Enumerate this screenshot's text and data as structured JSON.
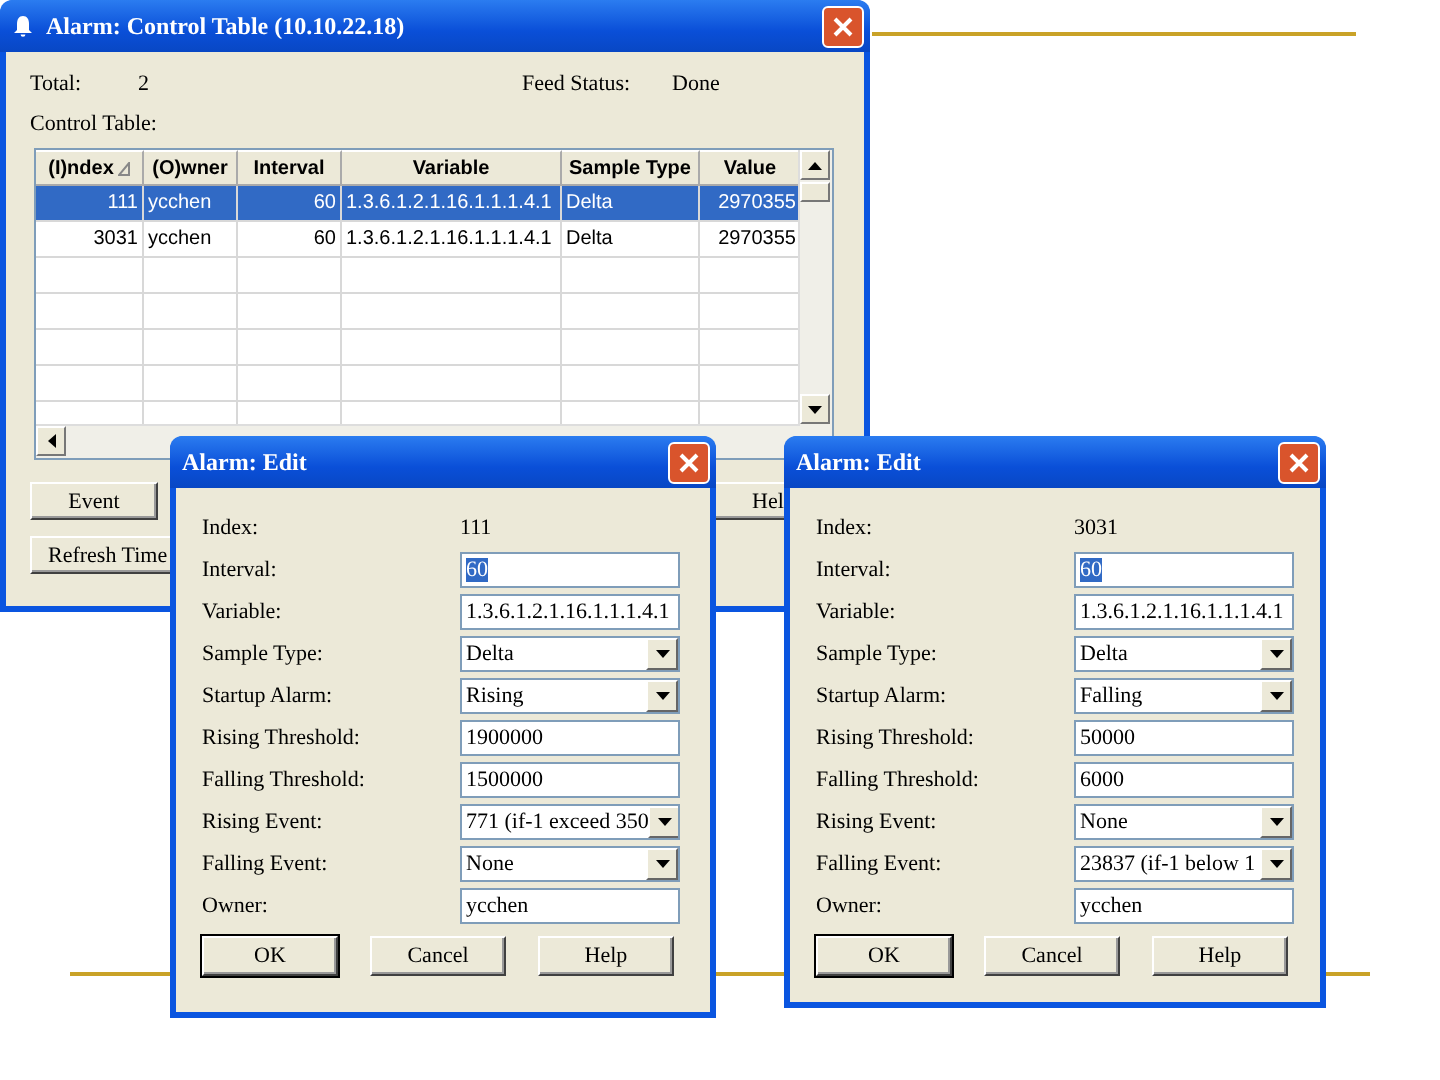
{
  "control_window": {
    "title": "Alarm: Control Table (10.10.22.18)",
    "total_label": "Total:",
    "total_value": "2",
    "feed_status_label": "Feed Status:",
    "feed_status_value": "Done",
    "table_label": "Control Table:",
    "table": {
      "columns": [
        {
          "label": "(I)ndex",
          "sorted": true
        },
        {
          "label": "(O)wner",
          "sorted": false
        },
        {
          "label": "Interval",
          "sorted": false
        },
        {
          "label": "Variable",
          "sorted": false
        },
        {
          "label": "Sample Type",
          "sorted": false
        },
        {
          "label": "Value",
          "sorted": false
        }
      ],
      "rows": [
        {
          "cells": [
            "111",
            "ycchen",
            "60",
            "1.3.6.1.2.1.16.1.1.1.4.1",
            "Delta",
            "2970355"
          ],
          "selected": true
        },
        {
          "cells": [
            "3031",
            "ycchen",
            "60",
            "1.3.6.1.2.1.16.1.1.1.4.1",
            "Delta",
            "2970355"
          ],
          "selected": false
        }
      ]
    },
    "buttons": [
      "Event",
      "Refresh Time",
      "Hel"
    ]
  },
  "edit_dialogs": [
    {
      "title": "Alarm: Edit",
      "fields": [
        {
          "label": "Index:",
          "kind": "static",
          "value": "111"
        },
        {
          "label": "Interval:",
          "kind": "text",
          "value": "60",
          "highlighted": true
        },
        {
          "label": "Variable:",
          "kind": "text",
          "value": "1.3.6.1.2.1.16.1.1.1.4.1",
          "highlighted": false
        },
        {
          "label": "Sample Type:",
          "kind": "dropdown",
          "value": "Delta"
        },
        {
          "label": "Startup Alarm:",
          "kind": "dropdown",
          "value": "Rising"
        },
        {
          "label": "Rising Threshold:",
          "kind": "text",
          "value": "1900000",
          "highlighted": false
        },
        {
          "label": "Falling Threshold:",
          "kind": "text",
          "value": "1500000",
          "highlighted": false
        },
        {
          "label": "Rising Event:",
          "kind": "dropdown",
          "value": "771 (if-1 exceed 350"
        },
        {
          "label": "Falling Event:",
          "kind": "dropdown",
          "value": "None"
        },
        {
          "label": "Owner:",
          "kind": "text",
          "value": "ycchen",
          "highlighted": false
        }
      ],
      "buttons": [
        {
          "label": "OK",
          "default": true
        },
        {
          "label": "Cancel",
          "default": false
        },
        {
          "label": "Help",
          "default": false
        }
      ]
    },
    {
      "title": "Alarm: Edit",
      "fields": [
        {
          "label": "Index:",
          "kind": "static",
          "value": "3031"
        },
        {
          "label": "Interval:",
          "kind": "text",
          "value": "60",
          "highlighted": true
        },
        {
          "label": "Variable:",
          "kind": "text",
          "value": "1.3.6.1.2.1.16.1.1.1.4.1",
          "highlighted": false
        },
        {
          "label": "Sample Type:",
          "kind": "dropdown",
          "value": "Delta"
        },
        {
          "label": "Startup Alarm:",
          "kind": "dropdown",
          "value": "Falling"
        },
        {
          "label": "Rising Threshold:",
          "kind": "text",
          "value": "50000",
          "highlighted": false
        },
        {
          "label": "Falling Threshold:",
          "kind": "text",
          "value": "6000",
          "highlighted": false
        },
        {
          "label": "Rising Event:",
          "kind": "dropdown",
          "value": "None"
        },
        {
          "label": "Falling Event:",
          "kind": "dropdown",
          "value": "23837 (if-1 below 1"
        },
        {
          "label": "Owner:",
          "kind": "text",
          "value": "ycchen",
          "highlighted": false
        }
      ],
      "buttons": [
        {
          "label": "OK",
          "default": true
        },
        {
          "label": "Cancel",
          "default": false
        },
        {
          "label": "Help",
          "default": false
        }
      ]
    }
  ]
}
